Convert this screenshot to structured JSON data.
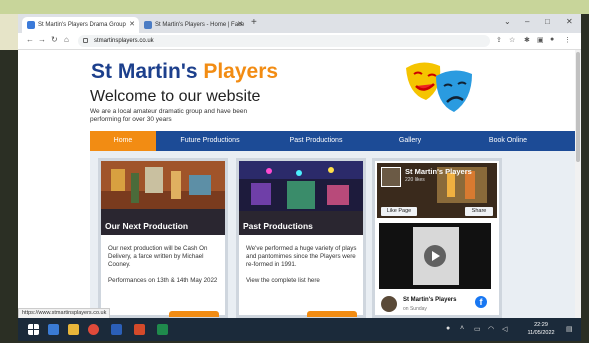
{
  "browser": {
    "tabs": [
      {
        "title": "St Martin's Players Drama Group",
        "active": true
      },
      {
        "title": "St Martin's Players - Home | Face",
        "active": false
      }
    ],
    "new_tab": "+",
    "window_controls": [
      "⌄",
      "–",
      "□",
      "✕"
    ],
    "nav": {
      "back": "←",
      "forward": "→",
      "reload": "↻",
      "home": "⌂"
    },
    "url": "stmartinsplayers.co.uk",
    "status_url": "https://www.stmartinsplayers.co.uk"
  },
  "site": {
    "logo_part1": "St Martin's ",
    "logo_part2": "Players",
    "welcome": "Welcome to our website",
    "intro": "We are a local amateur dramatic group and have been performing for over 30 years",
    "nav": [
      "Home",
      "Future Productions",
      "Past Productions",
      "Gallery",
      "Book Online"
    ],
    "nav_active": "Home",
    "cards": [
      {
        "title": "Our Next Production",
        "paragraphs": [
          "Our next production will be Cash On Delivery, a farce written by Michael Cooney.",
          "Performances on 13th & 14th May 2022"
        ]
      },
      {
        "title": "Past Productions",
        "paragraphs": [
          "We've performed a huge variety of plays and pantomimes since the Players were re-formed in 1991.",
          "View the complete list here"
        ]
      }
    ],
    "facebook": {
      "page_name": "St Martin's Players",
      "likes": "220 likes",
      "like_button": "Like Page",
      "share_button": "Share",
      "post_name": "St Martin's Players",
      "post_sub": "on Sunday",
      "f_glyph": "f"
    }
  },
  "taskbar": {
    "time": "22:29",
    "date": "11/05/2022"
  },
  "colors": {
    "brand_blue": "#1c4b96",
    "brand_orange": "#f28c13",
    "logo_blue": "#1c3f8c"
  }
}
